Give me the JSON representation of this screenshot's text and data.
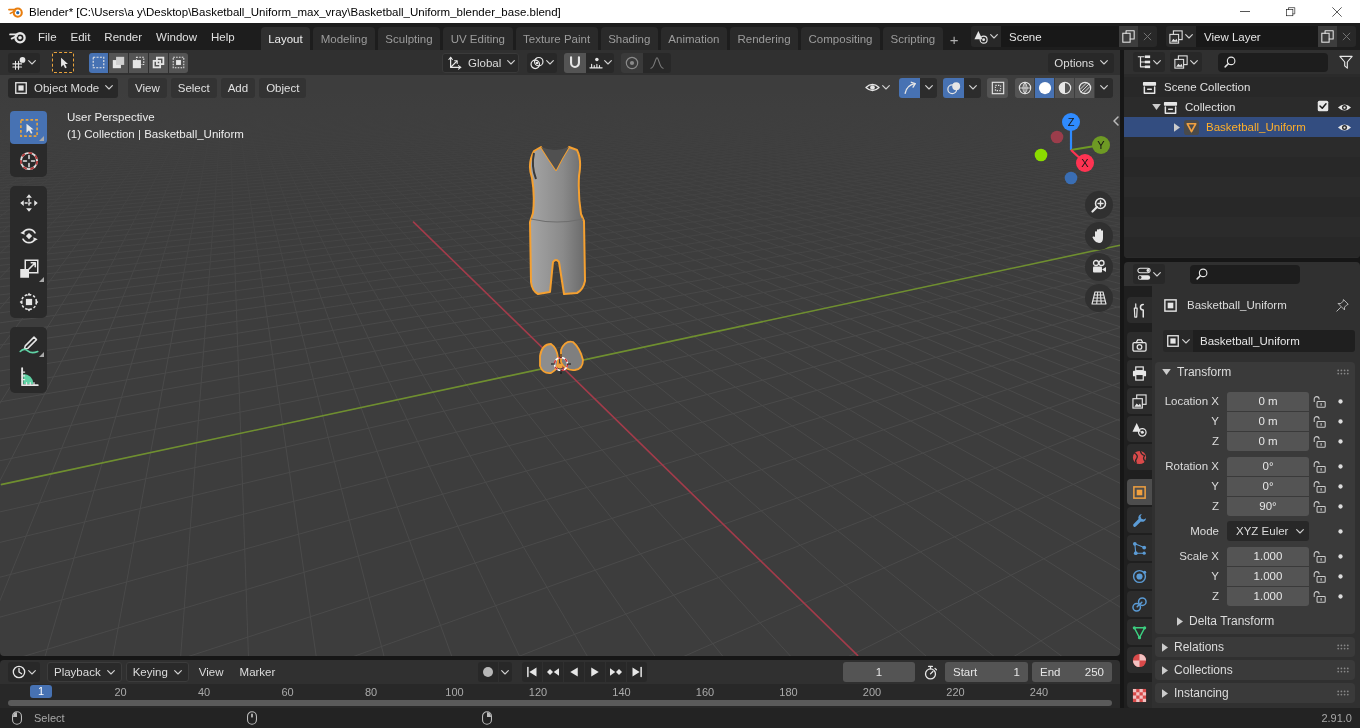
{
  "title_bar": {
    "title": "Blender* [C:\\Users\\a y\\Desktop\\Basketball_Uniform_max_vray\\Basketball_Uniform_blender_base.blend]"
  },
  "top_bar": {
    "menus": [
      "File",
      "Edit",
      "Render",
      "Window",
      "Help"
    ],
    "workspaces": [
      {
        "label": "Layout",
        "selected": true
      },
      {
        "label": "Modeling",
        "selected": false
      },
      {
        "label": "Sculpting",
        "selected": false
      },
      {
        "label": "UV Editing",
        "selected": false
      },
      {
        "label": "Texture Paint",
        "selected": false
      },
      {
        "label": "Shading",
        "selected": false
      },
      {
        "label": "Animation",
        "selected": false
      },
      {
        "label": "Rendering",
        "selected": false
      },
      {
        "label": "Compositing",
        "selected": false
      },
      {
        "label": "Scripting",
        "selected": false
      }
    ],
    "add_workspace": "+",
    "scene": "Scene",
    "view_layer": "View Layer"
  },
  "tool_header": {
    "select_modes": [
      {
        "kind": "set",
        "selected": true
      },
      {
        "kind": "extend",
        "selected": false
      },
      {
        "kind": "subtract",
        "selected": false
      },
      {
        "kind": "difference",
        "selected": false
      },
      {
        "kind": "intersect",
        "selected": false
      }
    ],
    "orientation": "Global",
    "options": "Options"
  },
  "viewport_header": {
    "mode": "Object Mode",
    "menus": [
      "View",
      "Select",
      "Add",
      "Object"
    ],
    "toggles": [
      {
        "kind": "gizmos",
        "on": true
      },
      {
        "kind": "overlays",
        "on": true
      },
      {
        "kind": "xray",
        "on": false
      }
    ],
    "shading": [
      {
        "kind": "wireframe",
        "selected": false
      },
      {
        "kind": "solid",
        "selected": true
      },
      {
        "kind": "material",
        "selected": false
      },
      {
        "kind": "rendered",
        "selected": false
      }
    ]
  },
  "viewport": {
    "info": [
      "User Perspective",
      "(1) Collection | Basketball_Uniform"
    ],
    "tool_groups": [
      {
        "tools": [
          {
            "kind": "select_box",
            "selected": true,
            "more": true
          },
          {
            "kind": "cursor",
            "selected": false,
            "more": false
          }
        ]
      },
      {
        "tools": [
          {
            "kind": "move",
            "selected": false,
            "more": false
          },
          {
            "kind": "rotate",
            "selected": false,
            "more": false
          },
          {
            "kind": "scale",
            "selected": false,
            "more": true
          },
          {
            "kind": "transform",
            "selected": false,
            "more": false
          }
        ]
      },
      {
        "tools": [
          {
            "kind": "annotate",
            "selected": false,
            "more": true
          },
          {
            "kind": "measure",
            "selected": false,
            "more": false
          }
        ]
      }
    ],
    "gizmo_axes": [
      {
        "kind": "z",
        "label": "Z",
        "color": "#2f8bff"
      },
      {
        "kind": "y",
        "label": "Y",
        "color": "#6e9a24"
      },
      {
        "kind": "x",
        "label": "X",
        "color": "#ff3352"
      }
    ]
  },
  "outliner": {
    "tree": [
      {
        "label": "Scene Collection",
        "kind": "scene_collection",
        "selected": false,
        "children": [
          {
            "label": "Collection",
            "kind": "collection",
            "selected": false,
            "expanded": true,
            "checked": true,
            "visible": true,
            "children": [
              {
                "label": "Basketball_Uniform",
                "kind": "mesh_object",
                "selected": true,
                "expanded": false,
                "visible": true
              }
            ]
          }
        ]
      }
    ]
  },
  "properties": {
    "tab_groups": [
      {
        "tabs": [
          {
            "kind": "tool",
            "selected": false
          }
        ]
      },
      {
        "tabs": [
          {
            "kind": "render",
            "selected": false
          },
          {
            "kind": "output",
            "selected": false
          },
          {
            "kind": "view_layer",
            "selected": false
          },
          {
            "kind": "scene",
            "selected": false
          },
          {
            "kind": "world",
            "selected": false
          }
        ]
      },
      {
        "tabs": [
          {
            "kind": "object",
            "selected": true
          },
          {
            "kind": "modifiers",
            "selected": false
          },
          {
            "kind": "particles",
            "selected": false
          },
          {
            "kind": "physics",
            "selected": false
          },
          {
            "kind": "constraints",
            "selected": false
          },
          {
            "kind": "data",
            "selected": false
          },
          {
            "kind": "material",
            "selected": false
          }
        ]
      },
      {
        "tabs": [
          {
            "kind": "texture",
            "selected": false
          }
        ]
      }
    ],
    "object_name": "Basketball_Uniform",
    "name_field": "Basketball_Uniform",
    "transform": {
      "title": "Transform",
      "expanded": true,
      "groups": [
        {
          "rows": [
            {
              "kind": "number",
              "label": "Location X",
              "value": "0 m",
              "locked": false
            },
            {
              "kind": "number",
              "label": "Y",
              "value": "0 m",
              "locked": false
            },
            {
              "kind": "number",
              "label": "Z",
              "value": "0 m",
              "locked": false
            }
          ]
        },
        {
          "rows": [
            {
              "kind": "number",
              "label": "Rotation X",
              "value": "0°",
              "locked": false
            },
            {
              "kind": "number",
              "label": "Y",
              "value": "0°",
              "locked": false
            },
            {
              "kind": "number",
              "label": "Z",
              "value": "90°",
              "locked": false
            }
          ]
        },
        {
          "rows": [
            {
              "kind": "dropdown",
              "label": "Mode",
              "value": "XYZ Euler"
            }
          ]
        },
        {
          "rows": [
            {
              "kind": "number",
              "label": "Scale X",
              "value": "1.000",
              "locked": false
            },
            {
              "kind": "number",
              "label": "Y",
              "value": "1.000",
              "locked": false
            },
            {
              "kind": "number",
              "label": "Z",
              "value": "1.000",
              "locked": false
            }
          ]
        }
      ],
      "subpanels": [
        {
          "title": "Delta Transform",
          "expanded": false
        }
      ]
    },
    "panels": [
      {
        "title": "Relations",
        "expanded": false
      },
      {
        "title": "Collections",
        "expanded": false
      },
      {
        "title": "Instancing",
        "expanded": false
      }
    ]
  },
  "timeline": {
    "menus": [
      {
        "label": "Playback",
        "kind": "dropdown"
      },
      {
        "label": "Keying",
        "kind": "dropdown"
      },
      {
        "label": "View",
        "kind": "menu"
      },
      {
        "label": "Marker",
        "kind": "menu"
      }
    ],
    "auto_keying": false,
    "current_frame": "1",
    "start_label": "Start",
    "start": "1",
    "end_label": "End",
    "end": "250",
    "playhead": "1",
    "ruler": [
      "20",
      "40",
      "60",
      "80",
      "100",
      "120",
      "140",
      "160",
      "180",
      "200",
      "220",
      "240"
    ]
  },
  "status_bar": {
    "hints": [
      {
        "kind": "left",
        "label": "Select"
      },
      {
        "kind": "middle"
      },
      {
        "kind": "right"
      }
    ],
    "version": "2.91.0"
  }
}
